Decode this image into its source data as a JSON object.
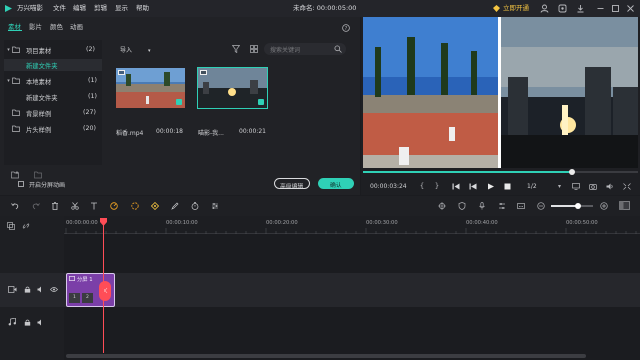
{
  "app": {
    "name": "万兴喵影",
    "project_title": "未命名: 00:00:05:00",
    "open_btn": "立即开通"
  },
  "menu": [
    "文件",
    "编辑",
    "剪辑",
    "显示",
    "帮助"
  ],
  "tabs": [
    "素材",
    "影片",
    "颜色",
    "动画"
  ],
  "tree": [
    {
      "label": "项目素材",
      "count": "(2)"
    },
    {
      "label": "新建文件夹",
      "count": ""
    },
    {
      "label": "本地素材",
      "count": "(1)"
    },
    {
      "label": "新建文件夹",
      "count": "(1)"
    },
    {
      "label": "背景样例",
      "count": "(27)"
    },
    {
      "label": "片头样例",
      "count": "(20)"
    }
  ],
  "media_bar": {
    "import": "导入",
    "search_placeholder": "搜索关键词"
  },
  "clips": [
    {
      "name": "稻香.mp4",
      "duration": "00:00:18"
    },
    {
      "name": "喵影-我...",
      "duration": "00:00:21"
    }
  ],
  "split_toggle": "开启分屏动画",
  "advanced_edit": "高级编辑",
  "confirm": "确认",
  "player": {
    "timecode": "00:00:03:24",
    "quality": "1/2",
    "progress": 0.76
  },
  "ruler": [
    "00:00:00:00",
    "00:00:10:00",
    "00:00:20:00",
    "00:00:30:00",
    "00:00:40:00",
    "00:00:50:00"
  ],
  "timeline_clip": {
    "label": "分屏 1",
    "slot1": "1",
    "slot2": "2"
  },
  "colors": {
    "accent": "#2fd0b6",
    "playhead": "#ff4d57",
    "clip": "#7b3fa8"
  }
}
